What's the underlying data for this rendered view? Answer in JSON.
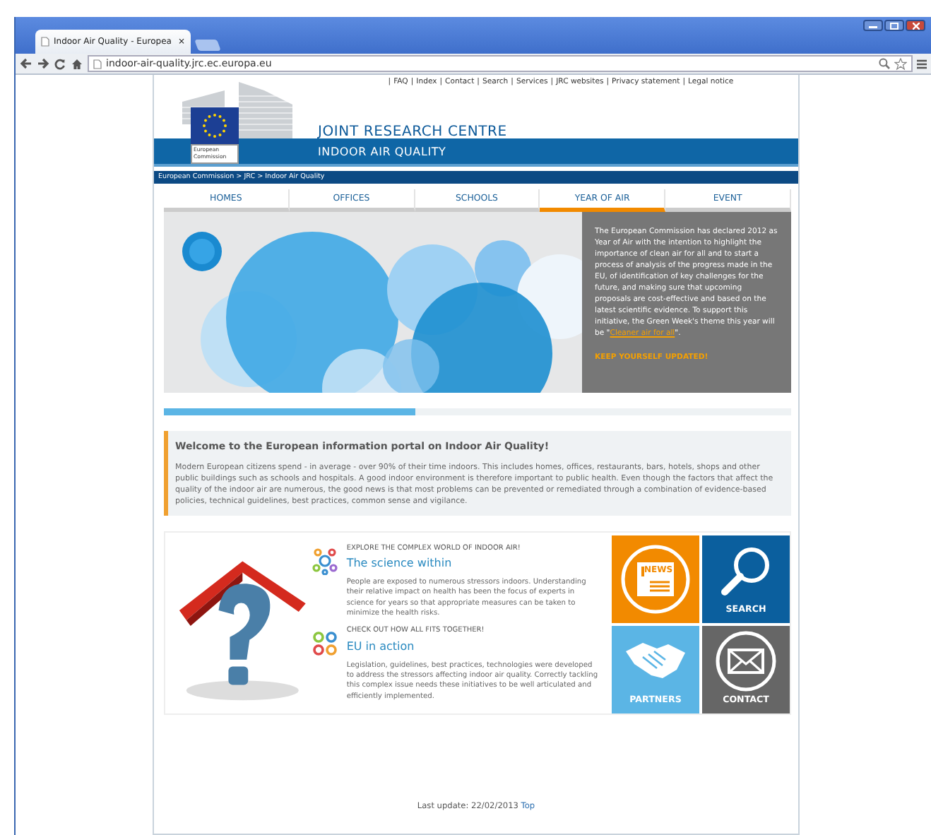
{
  "browser": {
    "tab_title": "Indoor Air Quality - Europea",
    "tab_close": "×",
    "url": "indoor-air-quality.jrc.ec.europa.eu"
  },
  "top_links": {
    "separator": "|",
    "items": [
      "FAQ",
      "Index",
      "Contact",
      "Search",
      "Services",
      "JRC websites",
      "Privacy statement",
      "Legal notice"
    ]
  },
  "logo": {
    "caption": [
      "European",
      "Commission"
    ]
  },
  "site_title": "JOINT RESEARCH CENTRE",
  "site_subtitle": "INDOOR AIR QUALITY",
  "breadcrumb": {
    "separator": ">",
    "items": [
      "European Commission",
      "JRC",
      "Indoor Air Quality"
    ]
  },
  "nav": [
    {
      "label": "HOMES",
      "selected": false
    },
    {
      "label": "OFFICES",
      "selected": false
    },
    {
      "label": "SCHOOLS",
      "selected": false
    },
    {
      "label": "YEAR OF AIR",
      "selected": true
    },
    {
      "label": "EVENT",
      "selected": false
    }
  ],
  "banner": {
    "kind": "picture",
    "text_before": "The European Commission has declared 2012 as Year of Air with the intention to highlight the importance of clean air for all and to start a process of analysis of the progress made in the EU, of identification of key challenges for the future, and making sure that upcoming proposals are cost-effective and based on the latest scientific evidence. To support this initiative, the Green Week's theme this year will be \"",
    "link": "Cleaner air for all",
    "text_after": "\".",
    "cta": "KEEP YOURSELF UPDATED!"
  },
  "slider": {
    "level": 0.4
  },
  "welcome": {
    "title": "Welcome to the European information portal on Indoor Air Quality!",
    "body": "Modern European citizens spend - in average - over 90% of their time indoors. This includes homes, offices, restaurants, bars, hotels, shops and other public buildings such as schools and hospitals. A good indoor environment is therefore important to public health. Even though the factors that affect the quality of the indoor air are numerous, the good news is that most problems can be prevented or remediated through a combination of evidence-based policies, technical guidelines, best practices, common sense and vigilance."
  },
  "features": [
    {
      "kind": "molecule",
      "kicker": "EXPLORE THE COMPLEX WORLD OF INDOOR AIR!",
      "title": "The science within",
      "body": "People are exposed to numerous stressors indoors. Understanding their relative impact on health has been the focus of experts in science for years so that appropriate measures can be taken to minimize the health risks."
    },
    {
      "kind": "pins",
      "kicker": "CHECK OUT HOW ALL FITS TOGETHER!",
      "title": "EU in action",
      "body": "Legislation, guidelines, best practices, technologies were developed to address the stressors affecting indoor air quality. Correctly tackling this complex issue needs these initiatives to be well articulated and efficiently implemented."
    }
  ],
  "tiles": [
    {
      "kind": "news",
      "label": "NEWS",
      "color": "#f28a00"
    },
    {
      "kind": "search",
      "label": "SEARCH",
      "color": "#0b5f9e"
    },
    {
      "kind": "partners",
      "label": "PARTNERS",
      "color": "#5bb5e5"
    },
    {
      "kind": "contact",
      "label": "CONTACT",
      "color": "#666666"
    }
  ],
  "footer": {
    "text": "Last update: 22/02/2013",
    "link": "Top"
  }
}
